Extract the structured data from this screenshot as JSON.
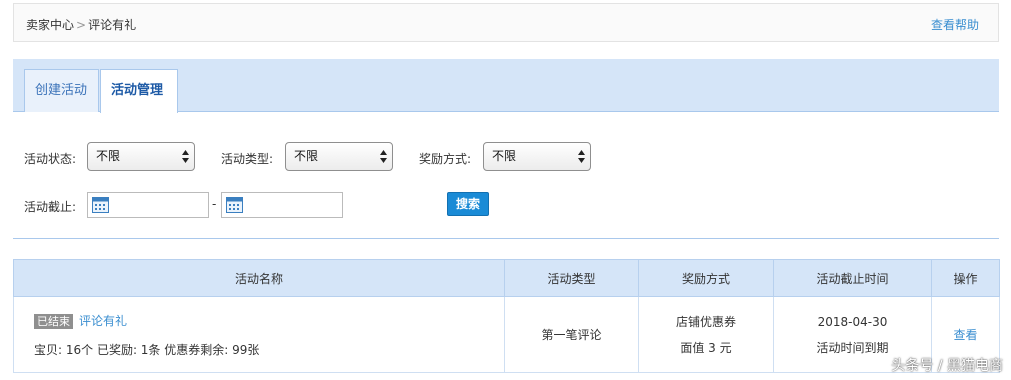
{
  "breadcrumb": {
    "root": "卖家中心",
    "separator": ">",
    "current": "评论有礼"
  },
  "help_link": "查看帮助",
  "tabs": [
    {
      "label": "创建活动",
      "active": false
    },
    {
      "label": "活动管理",
      "active": true
    }
  ],
  "filters": {
    "status": {
      "label": "活动状态:",
      "value": "不限"
    },
    "type": {
      "label": "活动类型:",
      "value": "不限"
    },
    "reward": {
      "label": "奖励方式:",
      "value": "不限"
    },
    "deadline": {
      "label": "活动截止:",
      "separator": "-"
    },
    "search_button": "搜索"
  },
  "table": {
    "headers": [
      "活动名称",
      "活动类型",
      "奖励方式",
      "活动截止时间",
      "操作"
    ],
    "rows": [
      {
        "status_badge": "已结束",
        "activity_name": "评论有礼",
        "details": "宝贝: 16个  已奖励: 1条  优惠券剩余: 99张",
        "activity_type": "第一笔评论",
        "reward_line1": "店铺优惠券",
        "reward_line2": "面值 3 元",
        "deadline_date": "2018-04-30",
        "deadline_note": "活动时间到期",
        "action": "查看"
      }
    ]
  },
  "watermark": "头条号 / 黑猫电商",
  "colors": {
    "accent": "#3a8ed0",
    "header_bg": "#d5e5f8",
    "button": "#1a8bd6",
    "badge": "#8f8f8f"
  }
}
